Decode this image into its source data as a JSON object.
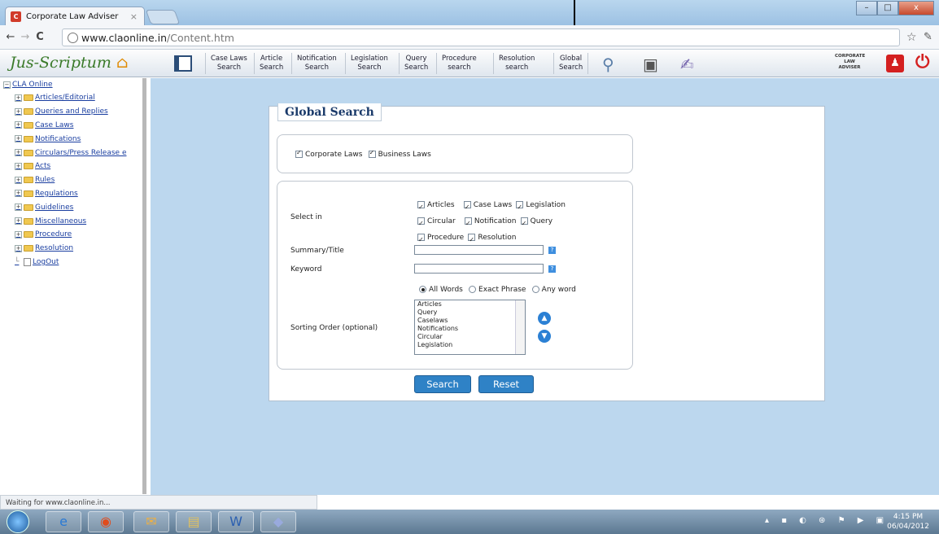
{
  "browser": {
    "tab_title": "Corporate Law Adviser",
    "tab_close": "×",
    "url_domain": "www.claonline.in",
    "url_path": "/Content.htm",
    "window_min": "–",
    "window_max": "□",
    "window_close": "x"
  },
  "toolbar": {
    "logo": "Jus-Scriptum",
    "items": [
      {
        "l1": "Case Laws",
        "l2": "Search"
      },
      {
        "l1": "Article",
        "l2": "Search"
      },
      {
        "l1": "Notification",
        "l2": "Search"
      },
      {
        "l1": "Legislation",
        "l2": "Search"
      },
      {
        "l1": "Query",
        "l2": "Search"
      },
      {
        "l1": "Procedure",
        "l2": "search"
      },
      {
        "l1": "Resolution",
        "l2": "search"
      },
      {
        "l1": "Global",
        "l2": "Search"
      }
    ],
    "cla_logo": "CORPORATE LAW ADVISER"
  },
  "sidebar": {
    "root": "CLA Online",
    "items": [
      "Articles/Editorial",
      "Queries and Replies",
      "Case Laws",
      "Notifications",
      "Circulars/Press Release e",
      "Acts",
      "Rules",
      "Regulations",
      "Guidelines",
      "Miscellaneous",
      "Procedure",
      "Resolution"
    ],
    "logout": "LogOut"
  },
  "status": "Waiting for www.claonline.in...",
  "search": {
    "title": "Global Search",
    "scope": [
      "Corporate Laws",
      "Business Laws"
    ],
    "select_in_label": "Select in",
    "select_in": [
      [
        "Articles",
        "Case Laws",
        "Legislation"
      ],
      [
        "Circular",
        "Notification",
        "Query"
      ],
      [
        "Procedure",
        "Resolution"
      ]
    ],
    "summary_label": "Summary/Title",
    "keyword_label": "Keyword",
    "help": "?",
    "match_options": [
      "All Words",
      "Exact Phrase",
      "Any word"
    ],
    "match_selected": "All Words",
    "sorting_label": "Sorting Order (optional)",
    "sorting_items": [
      "Articles",
      "Query",
      "Caselaws",
      "Notifications",
      "Circular",
      "Legislation"
    ],
    "search_button": "Search",
    "reset_button": "Reset"
  },
  "taskbar": {
    "time": "4:15 PM",
    "date": "06/04/2012"
  }
}
